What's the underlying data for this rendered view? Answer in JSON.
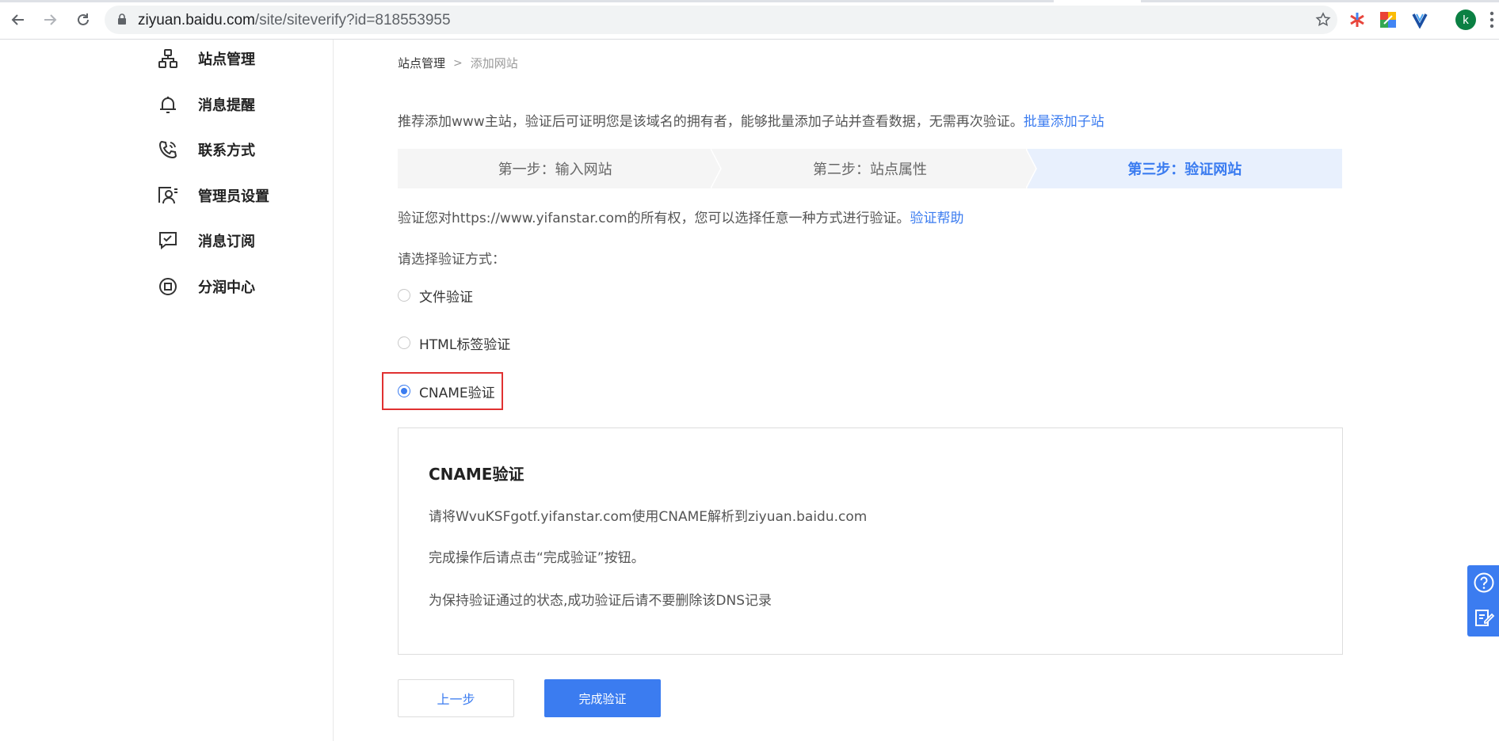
{
  "browser": {
    "url_host": "ziyuan.baidu.com",
    "url_path": "/site/siteverify?id=818553955",
    "avatar_letter": "k"
  },
  "sidebar": {
    "items": [
      {
        "label": "站点管理",
        "icon": "sitemap-icon"
      },
      {
        "label": "消息提醒",
        "icon": "bell-icon"
      },
      {
        "label": "联系方式",
        "icon": "phone-icon"
      },
      {
        "label": "管理员设置",
        "icon": "admin-icon"
      },
      {
        "label": "消息订阅",
        "icon": "subscribe-icon"
      },
      {
        "label": "分润中心",
        "icon": "revenue-icon"
      }
    ]
  },
  "breadcrumb": {
    "root": "站点管理",
    "separator": ">",
    "current": "添加网站"
  },
  "intro": {
    "text": "推荐添加www主站，验证后可证明您是该域名的拥有者，能够批量添加子站并查看数据，无需再次验证。",
    "link": "批量添加子站"
  },
  "steps": [
    {
      "label": "第一步：输入网站",
      "active": false
    },
    {
      "label": "第二步：站点属性",
      "active": false
    },
    {
      "label": "第三步：验证网站",
      "active": true
    }
  ],
  "verify": {
    "desc": "验证您对https://www.yifanstar.com的所有权，您可以选择任意一种方式进行验证。",
    "help_link": "验证帮助",
    "choose_label": "请选择验证方式：",
    "options": [
      {
        "label": "文件验证",
        "checked": false
      },
      {
        "label": "HTML标签验证",
        "checked": false
      },
      {
        "label": "CNAME验证",
        "checked": true
      }
    ]
  },
  "panel": {
    "title": "CNAME验证",
    "line1": "请将WvuKSFgotf.yifanstar.com使用CNAME解析到ziyuan.baidu.com",
    "line2": "完成操作后请点击“完成验证”按钮。",
    "line3": "为保持验证通过的状态,成功验证后请不要删除该DNS记录"
  },
  "buttons": {
    "prev": "上一步",
    "done": "完成验证"
  },
  "colors": {
    "accent": "#3b7cf0",
    "highlight": "#e03131"
  }
}
